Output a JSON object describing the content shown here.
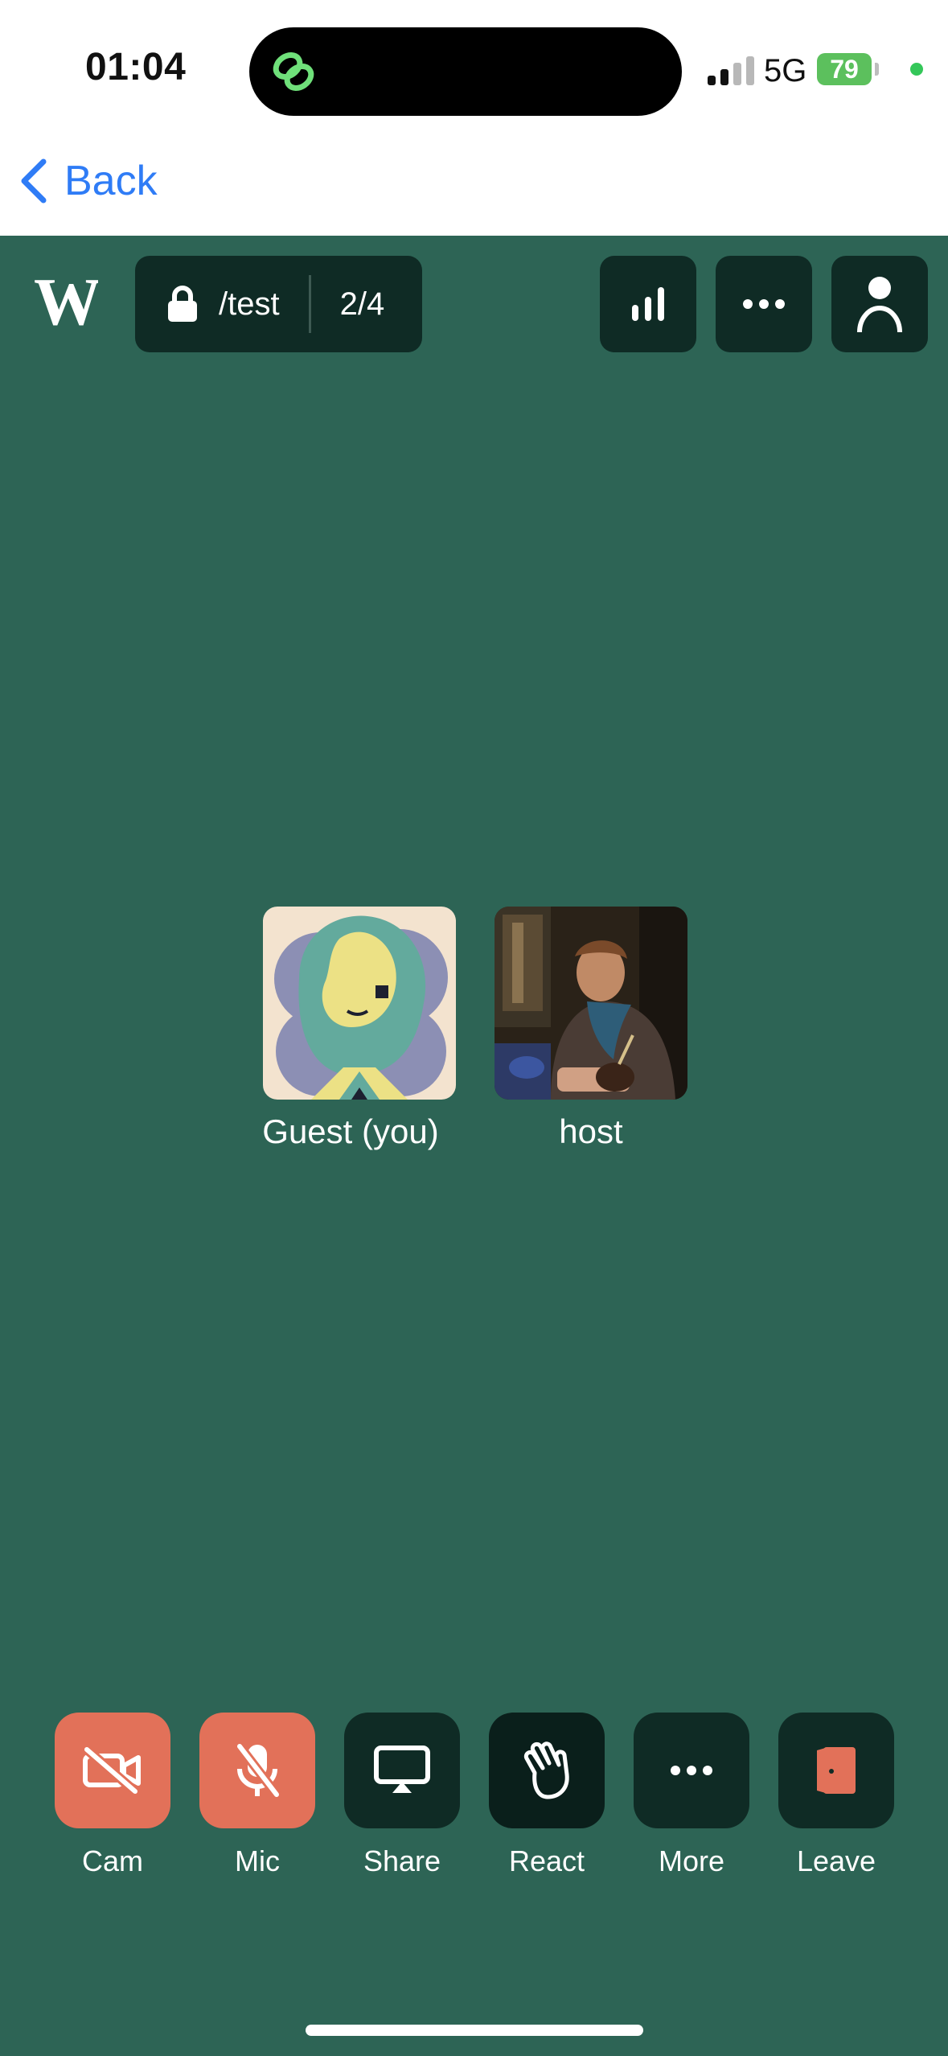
{
  "status_bar": {
    "time": "01:04",
    "network": "5G",
    "battery": "79"
  },
  "nav": {
    "back_label": "Back"
  },
  "room": {
    "name": "/test",
    "participant_count": "2/4"
  },
  "participants": [
    {
      "label": "Guest (you)"
    },
    {
      "label": "host"
    }
  ],
  "controls": [
    {
      "label": "Cam"
    },
    {
      "label": "Mic"
    },
    {
      "label": "Share"
    },
    {
      "label": "React"
    },
    {
      "label": "More"
    },
    {
      "label": "Leave"
    }
  ],
  "colors": {
    "call_background": "#2d6455",
    "button_dark": "#0f2b25",
    "button_muted": "#e27159",
    "link_blue": "#2f7cf6"
  }
}
